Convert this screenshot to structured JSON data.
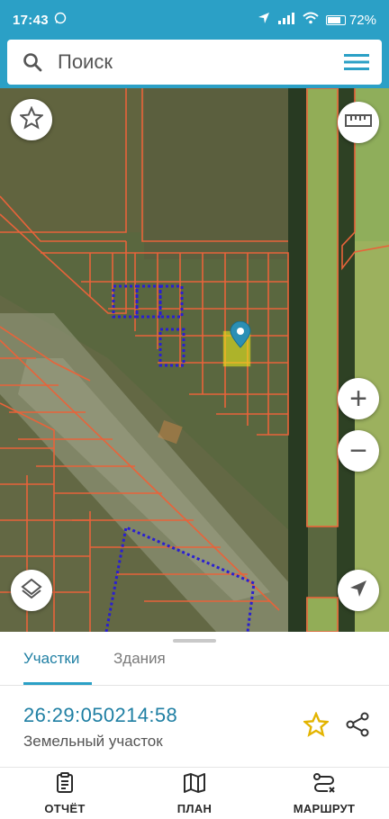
{
  "status_bar": {
    "time": "17:43",
    "battery": "72%"
  },
  "search": {
    "placeholder": "Поиск"
  },
  "map": {
    "controls": {
      "favorites": "star-icon",
      "ruler": "ruler-icon",
      "zoom_in": "+",
      "zoom_out": "−",
      "layers": "layers-icon",
      "locate": "navigation-arrow-icon"
    },
    "colors": {
      "parcel_border": "#e8633a",
      "selected_parcel": "#f2f21a",
      "dotted_parcel": "#2a1fd0",
      "marker": "#2b8fb5"
    }
  },
  "sheet": {
    "tabs": [
      {
        "label": "Участки",
        "active": true
      },
      {
        "label": "Здания",
        "active": false
      }
    ],
    "parcel": {
      "cadastral_number": "26:29:050214:58",
      "type": "Земельный участок"
    }
  },
  "nav": {
    "items": [
      {
        "label": "ОТЧЁТ",
        "icon": "report-icon"
      },
      {
        "label": "ПЛАН",
        "icon": "map-plan-icon"
      },
      {
        "label": "МАРШРУТ",
        "icon": "route-icon"
      }
    ]
  }
}
